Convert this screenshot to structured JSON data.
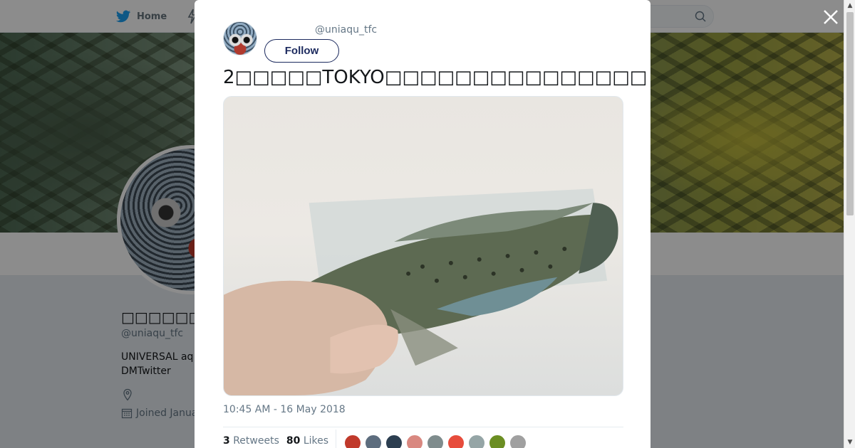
{
  "nav": {
    "home_label": "Home",
    "search_placeholder": ""
  },
  "profile": {
    "name": "□□□□□□□□□□",
    "handle": "@uniaqu_tfc",
    "bio": "UNIVERSAL aq DMTwitter",
    "joined": "Joined Janua"
  },
  "tweet": {
    "handle": "@uniaqu_tfc",
    "follow_label": "Follow",
    "text": "2□□□□□TOKYO□□□□□□□□□□□□□□□",
    "timestamp": "10:45 AM - 16 May 2018",
    "retweets_count": "3",
    "retweets_label": "Retweets",
    "likes_count": "80",
    "likes_label": "Likes",
    "liker_colors": [
      "#c0392b",
      "#5d6d7e",
      "#2c3e50",
      "#d98880",
      "#7f8c8d",
      "#e74c3c",
      "#95a5a6",
      "#6b8e23",
      "#a0a0a0"
    ]
  },
  "colors": {
    "accent": "#1c2a5e",
    "twitter_blue": "#1da1f2"
  },
  "icons": {
    "close": "close-icon",
    "home": "twitter-bird-icon",
    "search": "search-icon",
    "location": "location-pin-icon",
    "calendar": "calendar-icon"
  }
}
